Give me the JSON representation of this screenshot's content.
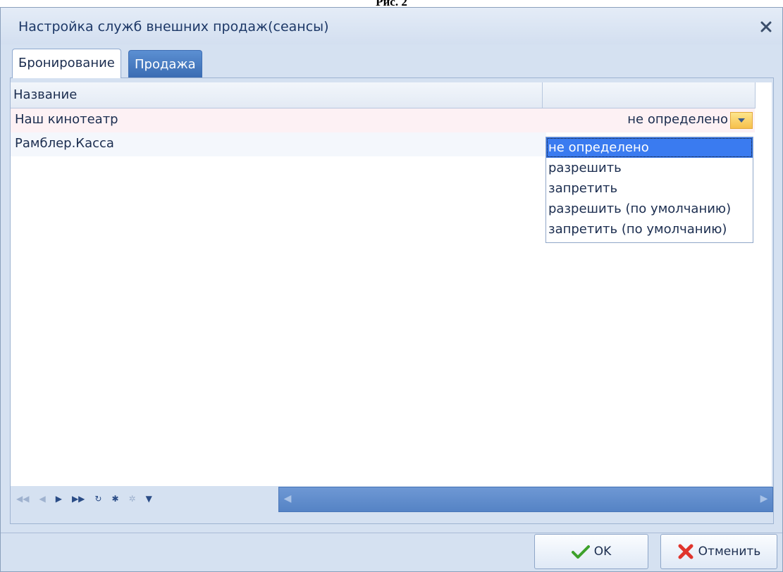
{
  "page_caption": "Рис. 2",
  "dialog": {
    "title": "Настройка служб внешних продаж(сеансы)",
    "close_icon": "close-icon"
  },
  "tabs": [
    {
      "label": "Бронирование",
      "active": true
    },
    {
      "label": "Продажа",
      "active": false
    }
  ],
  "grid": {
    "columns": [
      "Название",
      ""
    ],
    "rows": [
      {
        "name": "Наш кинотеатр",
        "value": "не определено"
      },
      {
        "name": "Рамблер.Касса",
        "value": ""
      }
    ]
  },
  "dropdown": {
    "options": [
      "не определено",
      "разрешить",
      "запретить",
      "разрешить (по умолчанию)",
      "запретить (по умолчанию)"
    ],
    "selected": "не определено"
  },
  "navigator": {
    "icons": [
      "first-icon",
      "prev-icon",
      "next-icon",
      "last-icon",
      "refresh-icon",
      "new-icon",
      "clear-icon",
      "filter-icon"
    ]
  },
  "buttons": {
    "ok_label": "OK",
    "cancel_label": "Отменить"
  },
  "colors": {
    "accent": "#3a7bf0",
    "tab_inactive": "#4a7cc1",
    "window_bg": "#d5e1f1"
  }
}
